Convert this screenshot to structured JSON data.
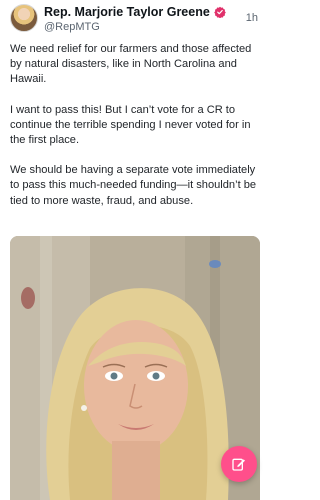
{
  "post": {
    "author_name": "Rep. Marjorie Taylor Greene",
    "handle": "@RepMTG",
    "timestamp": "1h",
    "paragraphs": [
      "We need relief for our farmers and those affected by natural disasters, like in North Carolina and Hawaii.",
      "I want to pass this! But I can’t vote for a CR to continue the terrible spending I never voted for in the first place.",
      "We should be having a separate vote immediately to pass this much-needed funding—it shouldn’t be tied to more waste, fraud, and abuse."
    ]
  },
  "icons": {
    "verified": "verified-badge-icon",
    "compose": "edit-pencil-icon"
  },
  "colors": {
    "verified": "#e0306a",
    "fab": "#ff4f8b",
    "text": "#0f1419",
    "muted": "#5b6570"
  }
}
